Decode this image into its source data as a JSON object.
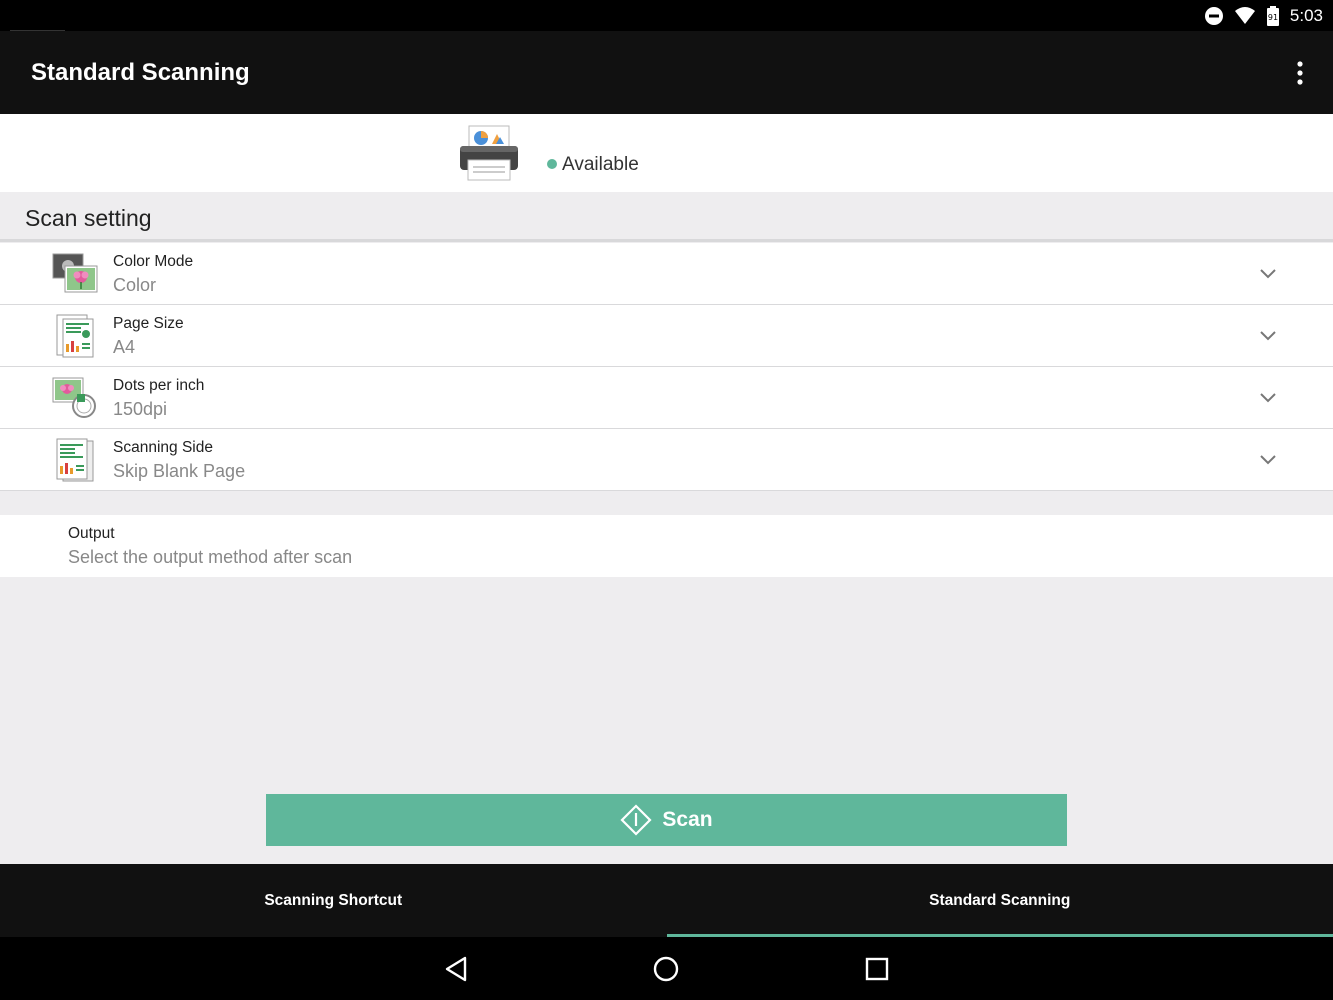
{
  "status_bar": {
    "time": "5:03",
    "icons": [
      "do-not-disturb-icon",
      "wifi-icon",
      "battery-icon"
    ]
  },
  "app_bar": {
    "title": "Standard Scanning",
    "menu_icon": "more-vert-icon"
  },
  "device": {
    "icon": "printer-icon",
    "status": "Available",
    "status_color": "#5fb79b"
  },
  "scan_setting": {
    "title": "Scan setting",
    "items": [
      {
        "label": "Color Mode",
        "value": "Color",
        "icon": "color-mode-icon"
      },
      {
        "label": "Page Size",
        "value": "A4",
        "icon": "page-size-icon"
      },
      {
        "label": "Dots per inch",
        "value": "150dpi",
        "icon": "dpi-icon"
      },
      {
        "label": "Scanning Side",
        "value": "Skip Blank Page",
        "icon": "scanning-side-icon"
      }
    ]
  },
  "output": {
    "label": "Output",
    "value": "Select the output method after scan"
  },
  "scan_button": {
    "label": "Scan",
    "icon": "scan-diamond-icon",
    "color": "#5fb79b"
  },
  "tabs": [
    {
      "label": "Scanning Shortcut",
      "active": false
    },
    {
      "label": "Standard Scanning",
      "active": true
    }
  ],
  "nav_bar": {
    "icons": [
      "back-icon",
      "home-icon",
      "recents-icon"
    ]
  },
  "colors": {
    "accent": "#5fb79b",
    "app_bar": "#111111",
    "background": "#eeedef"
  }
}
